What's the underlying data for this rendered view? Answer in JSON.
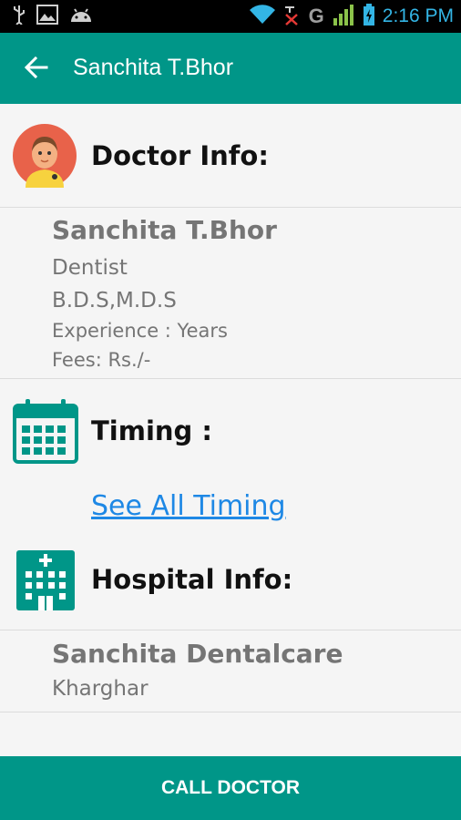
{
  "status_bar": {
    "time": "2:16 PM",
    "network_letter": "G",
    "left_icons": [
      "usb-icon",
      "image-icon",
      "android-icon"
    ],
    "right_icons": [
      "wifi-icon",
      "no-signal-icon",
      "cell-signal-icon",
      "battery-charging-icon"
    ]
  },
  "app_bar": {
    "title": "Sanchita T.Bhor",
    "back_icon": "arrow-left-icon"
  },
  "doctor_info": {
    "heading": "Doctor  Info:",
    "name": "Sanchita T.Bhor",
    "specialty": "Dentist",
    "qualification": "B.D.S,M.D.S",
    "experience": "Experience : Years",
    "fees": "Fees: Rs./-"
  },
  "timing": {
    "heading": "Timing :",
    "link": "See All Timing"
  },
  "hospital_info": {
    "heading": "Hospital  Info:",
    "name": "Sanchita Dentalcare",
    "area": "Kharghar"
  },
  "footer": {
    "call_label": "CALL DOCTOR"
  },
  "colors": {
    "primary": "#009688",
    "link": "#1e88e5",
    "status_accent": "#33b5e5"
  }
}
